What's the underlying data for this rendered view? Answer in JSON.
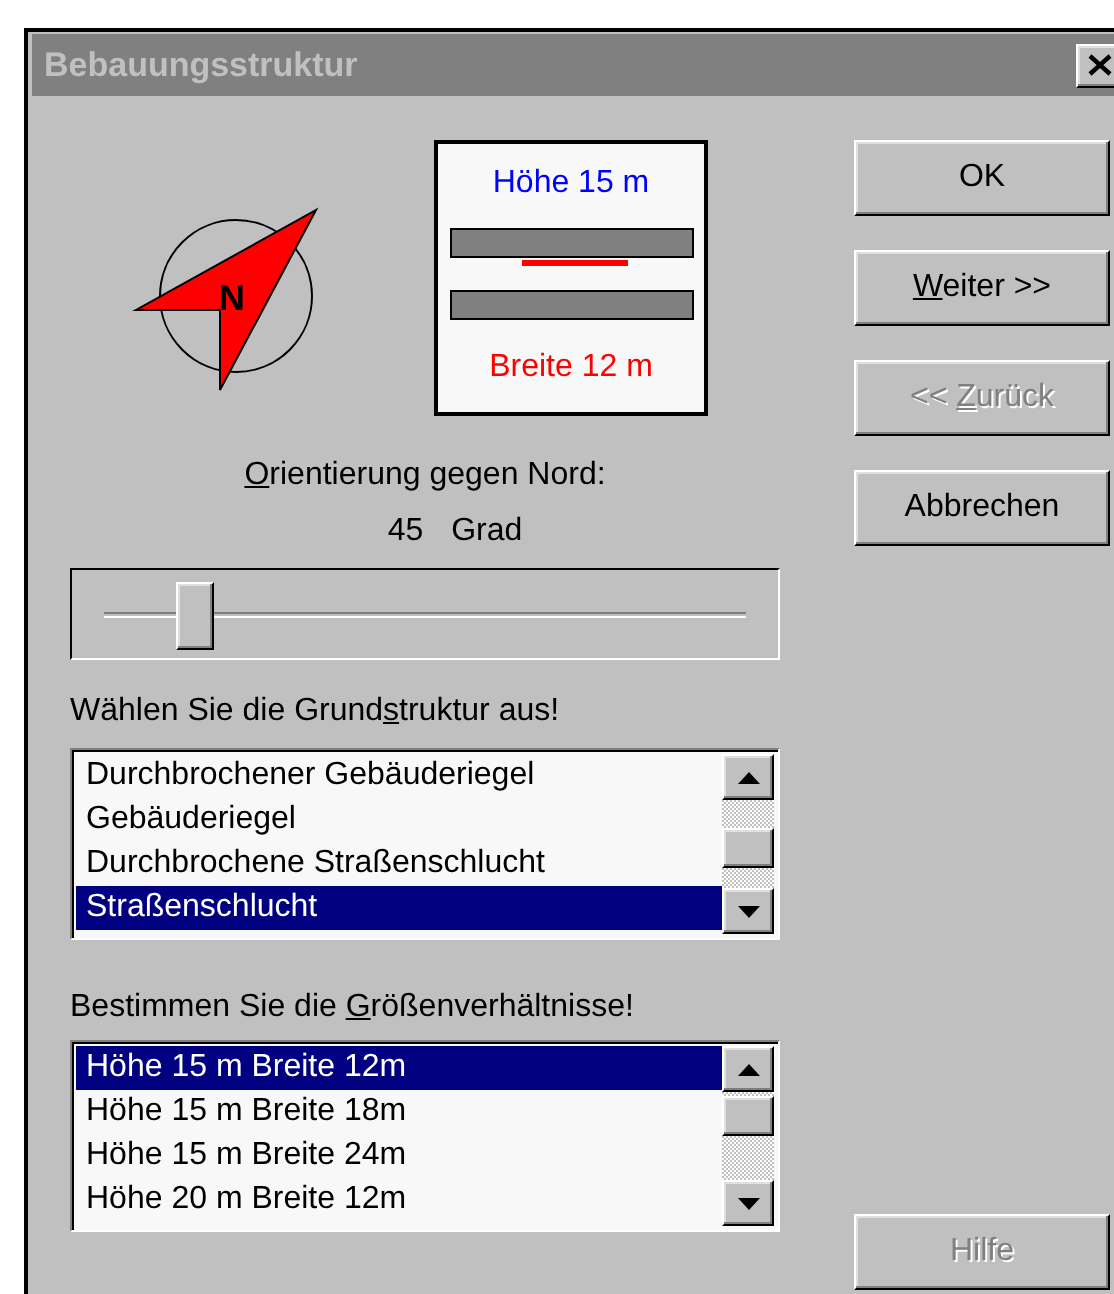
{
  "window": {
    "title": "Bebauungsstruktur"
  },
  "compass": {
    "label": "N"
  },
  "preview": {
    "height_label": "Höhe 15 m",
    "width_label": "Breite 12 m"
  },
  "orientation": {
    "label": {
      "key": "O",
      "after": "rientierung gegen Nord:"
    },
    "value": "45",
    "unit": "Grad",
    "level": 0.14
  },
  "structure": {
    "label": {
      "before": "Wählen Sie die Grund",
      "key": "s",
      "after": "truktur aus!"
    },
    "items": [
      {
        "text": "Durchbrochener Gebäuderiegel",
        "selected": false
      },
      {
        "text": "Gebäuderiegel",
        "selected": false
      },
      {
        "text": "Durchbrochene Straßenschlucht",
        "selected": false
      },
      {
        "text": "Straßenschlucht",
        "selected": true
      }
    ]
  },
  "proportions": {
    "label": {
      "before": "Bestimmen Sie die ",
      "key": "G",
      "after": "rößenverhältnisse!"
    },
    "items": [
      {
        "text": "Höhe 15 m Breite 12m",
        "selected": true
      },
      {
        "text": "Höhe 15 m Breite 18m",
        "selected": false
      },
      {
        "text": "Höhe 15 m Breite 24m",
        "selected": false
      },
      {
        "text": "Höhe 20 m Breite 12m",
        "selected": false
      }
    ]
  },
  "buttons": [
    {
      "label": {
        "after": "OK"
      },
      "disabled": false
    },
    {
      "label": {
        "key": "W",
        "after": "eiter >>"
      },
      "disabled": false
    },
    {
      "label": {
        "before": "<< ",
        "key": "Z",
        "after": "urück"
      },
      "disabled": true
    },
    {
      "label": {
        "after": "Abbrechen"
      },
      "disabled": false
    }
  ],
  "help_button": {
    "label": "Hilfe",
    "disabled": true
  }
}
